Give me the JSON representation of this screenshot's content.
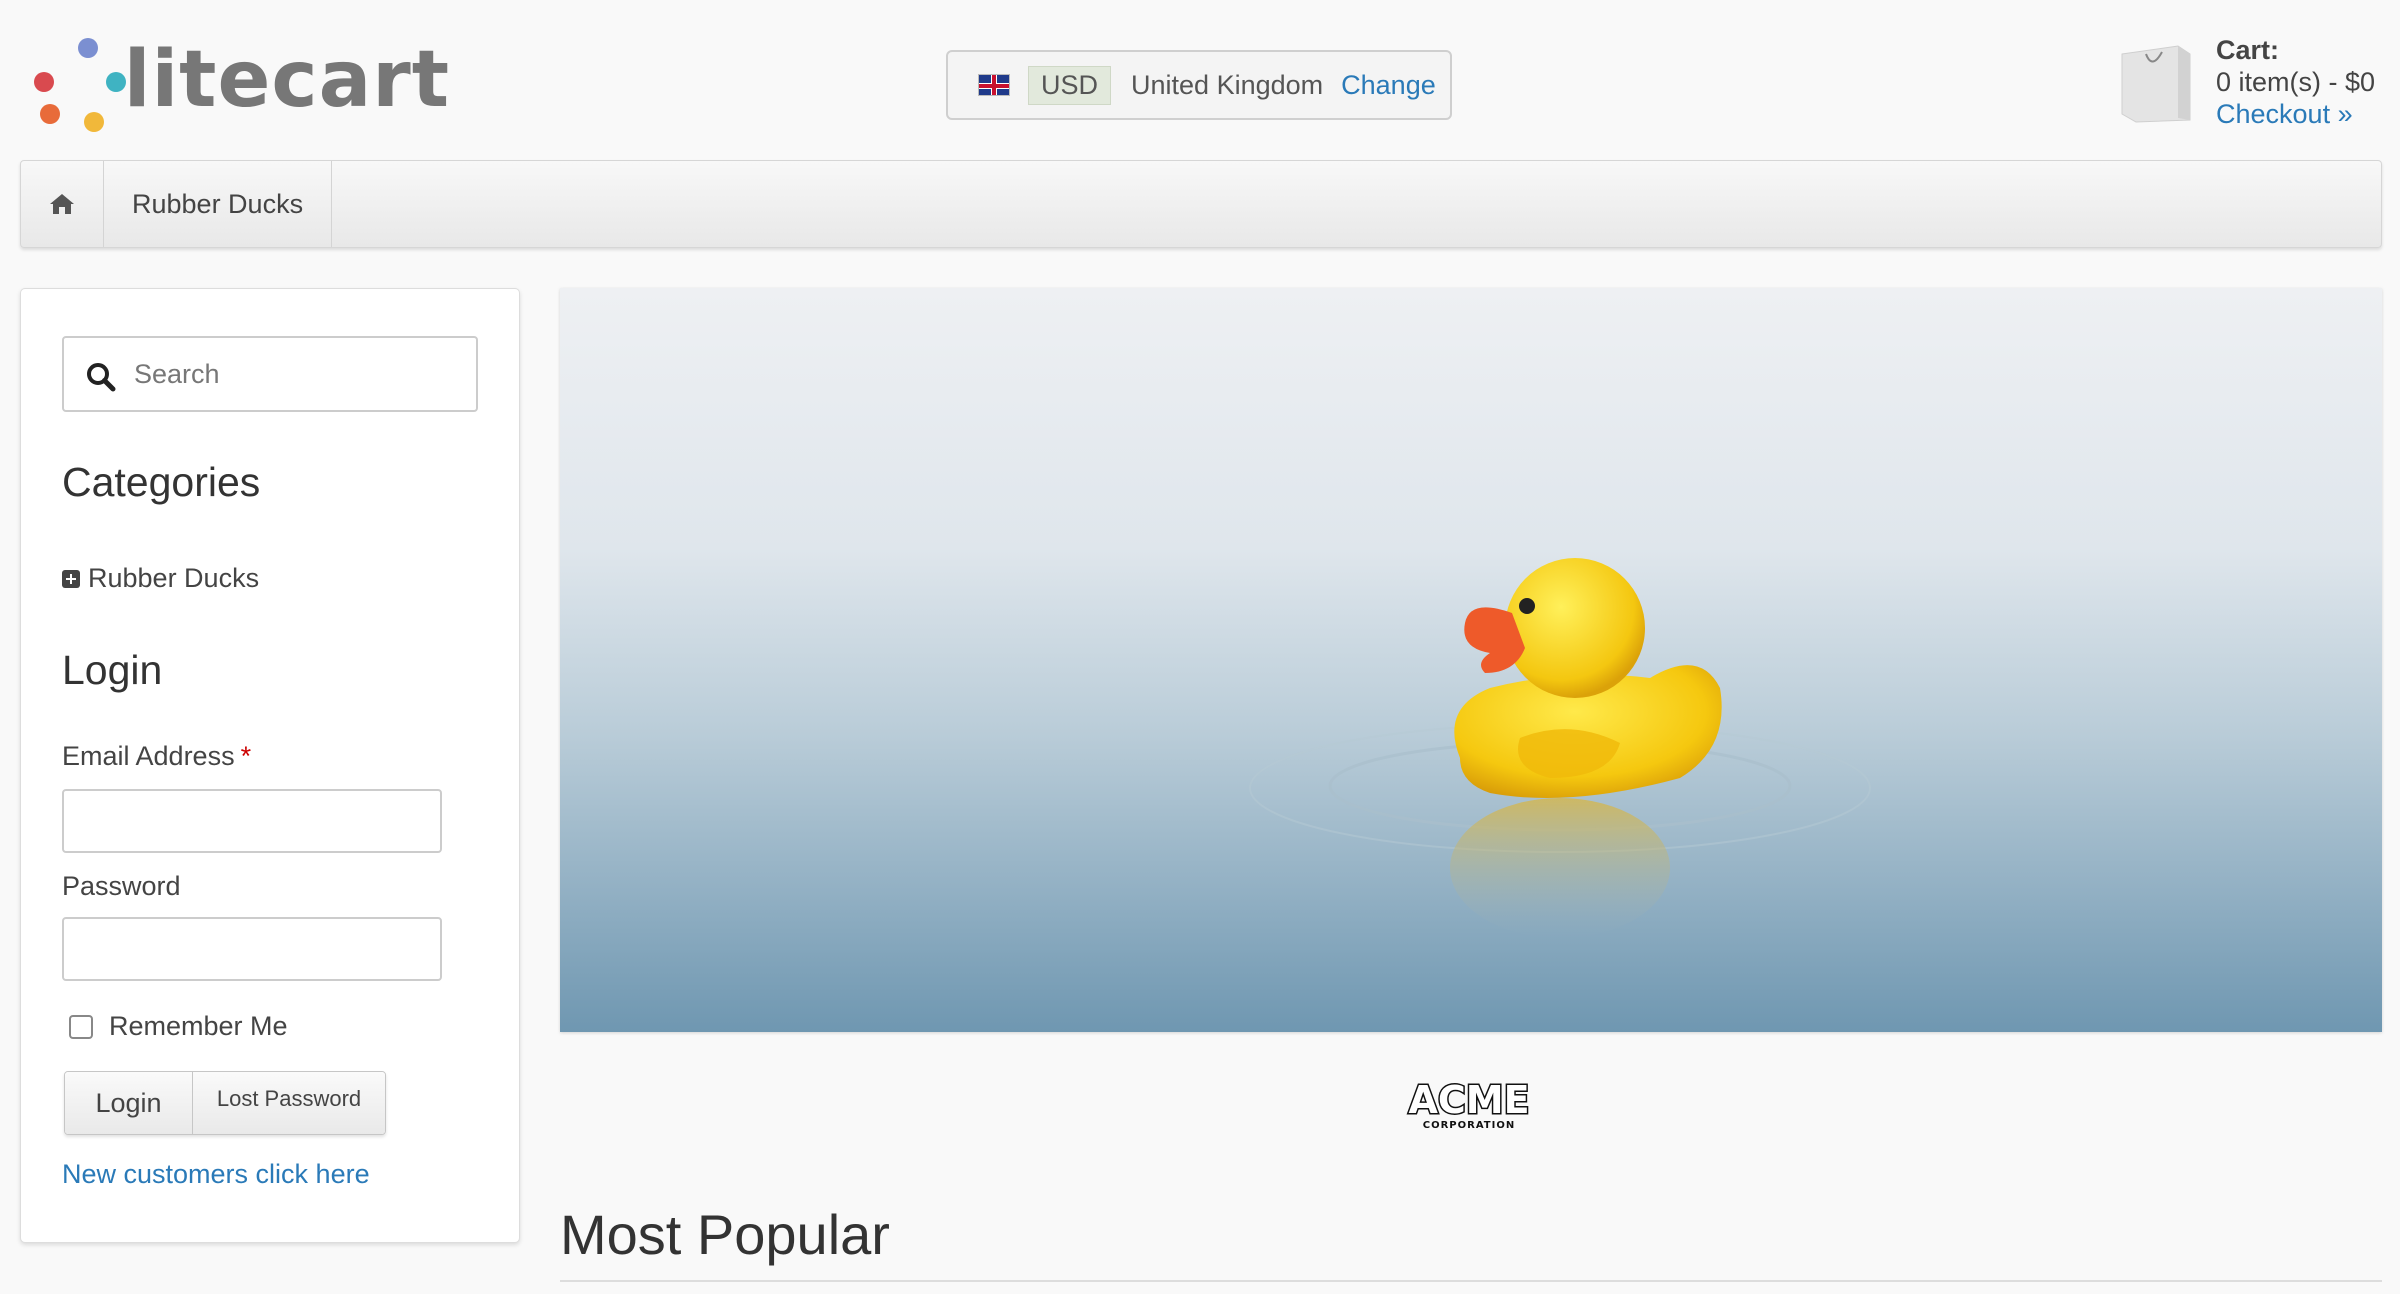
{
  "header": {
    "logo_text": "litecart",
    "logo_colors": [
      "#d94a4f",
      "#7b8fd1",
      "#3fb3c2",
      "#e86b3a",
      "#f1b83a"
    ],
    "region": {
      "flag_icon": "uk-flag-icon",
      "currency": "USD",
      "country": "United Kingdom",
      "change_label": "Change"
    },
    "cart": {
      "title": "Cart:",
      "summary": "0 item(s) - $0",
      "checkout_label": "Checkout »",
      "icon": "shopping-bag-icon"
    }
  },
  "nav": {
    "home_icon": "home-icon",
    "items": [
      {
        "label": "Rubber Ducks"
      }
    ]
  },
  "sidebar": {
    "search": {
      "placeholder": "Search",
      "value": ""
    },
    "categories_heading": "Categories",
    "categories": [
      {
        "label": "Rubber Ducks"
      }
    ],
    "login": {
      "heading": "Login",
      "email_label": "Email Address",
      "required_mark": "*",
      "email_value": "",
      "password_label": "Password",
      "password_value": "",
      "remember_label": "Remember Me",
      "login_button": "Login",
      "lost_password_button": "Lost Password",
      "new_customers_link": "New customers click here"
    }
  },
  "main": {
    "banner_subject": "rubber-duck-on-water",
    "manufacturer_logo_text": "ACME",
    "manufacturer_logo_subtext": "CORPORATION",
    "most_popular_heading": "Most Popular"
  },
  "colors": {
    "link": "#2a7ab8",
    "required": "#cc0000",
    "page_bg": "#f9f9f9"
  }
}
